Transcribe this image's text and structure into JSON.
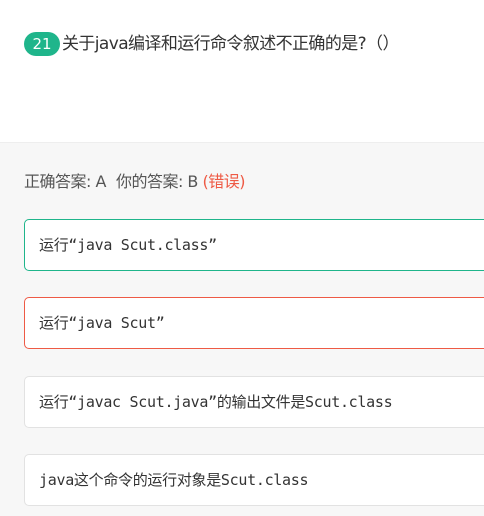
{
  "question": {
    "number": "21",
    "text": "关于java编译和运行命令叙述不正确的是?（）"
  },
  "result": {
    "correct_label": "正确答案: A",
    "your_label": "你的答案: B",
    "status": "(错误)",
    "colors": {
      "correct": "#1fb58b",
      "wrong": "#ee5a45"
    }
  },
  "options": [
    {
      "text": "运行“java Scut.class”",
      "state": "correct"
    },
    {
      "text": "运行“java Scut”",
      "state": "selected-wrong"
    },
    {
      "text": "运行“javac Scut.java”的输出文件是Scut.class",
      "state": "normal"
    },
    {
      "text": "java这个命令的运行对象是Scut.class",
      "state": "normal"
    }
  ]
}
